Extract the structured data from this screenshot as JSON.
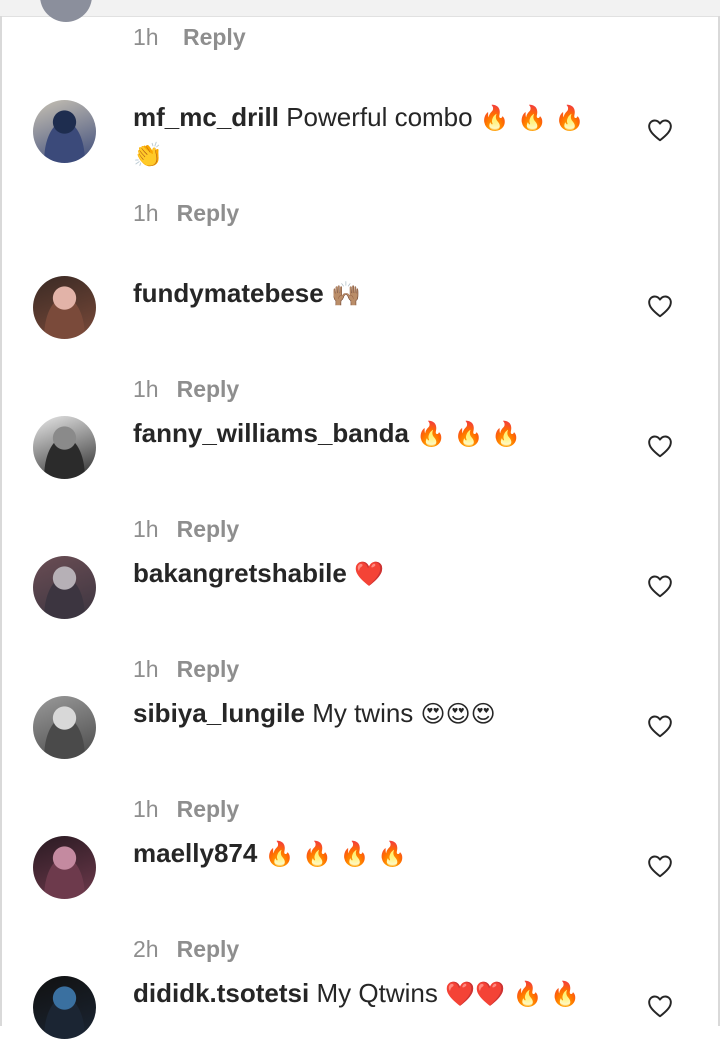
{
  "top": {
    "time": "1h",
    "reply_label": "Reply"
  },
  "comments": [
    {
      "username": "mf_mc_drill",
      "text": "Powerful combo",
      "emojis": "🔥 🔥 🔥",
      "emojis_line2": "👏",
      "time": "1h",
      "reply_label": "Reply",
      "avatar_colors": [
        "#3b4a7a",
        "#1e2d4f",
        "#c8c2b4"
      ]
    },
    {
      "username": "fundymatebese",
      "text": "",
      "emojis": "🙌🏽",
      "time": "1h",
      "reply_label": "Reply",
      "avatar_colors": [
        "#7a4a3a",
        "#e2b3a8",
        "#3a2a24"
      ]
    },
    {
      "username": "fanny_williams_banda",
      "text": "",
      "emojis": "🔥 🔥 🔥",
      "time": "1h",
      "reply_label": "Reply",
      "avatar_colors": [
        "#2b2b2b",
        "#8a8a8a",
        "#e9e9e9"
      ]
    },
    {
      "username": "bakangretshabile",
      "text": "",
      "emojis": "❤️",
      "time": "1h",
      "reply_label": "Reply",
      "avatar_colors": [
        "#3c3540",
        "#b6b0b6",
        "#6a4d54"
      ]
    },
    {
      "username": "sibiya_lungile",
      "text": "My twins",
      "emojis": "😍😍😍",
      "time": "1h",
      "reply_label": "Reply",
      "avatar_colors": [
        "#4a4a4a",
        "#d8d8d8",
        "#9a9a9a"
      ]
    },
    {
      "username": "maelly874",
      "text": "",
      "emojis": "🔥 🔥 🔥 🔥",
      "time": "2h",
      "reply_label": "Reply",
      "avatar_colors": [
        "#6d3a4c",
        "#c48aa0",
        "#2a1a22"
      ]
    },
    {
      "username": "dididk.tsotetsi",
      "text": "My Qtwins",
      "emojis": "❤️❤️ 🔥 🔥",
      "time": "",
      "reply_label": "",
      "avatar_colors": [
        "#1b2533",
        "#3a70a0",
        "#111111"
      ]
    }
  ],
  "colors": {
    "username": "#262626",
    "meta": "#8e8e8e",
    "heart_outline": "#262626",
    "accent_fire": "#f5900c"
  },
  "icons": {
    "like": "heart-outline-icon"
  }
}
